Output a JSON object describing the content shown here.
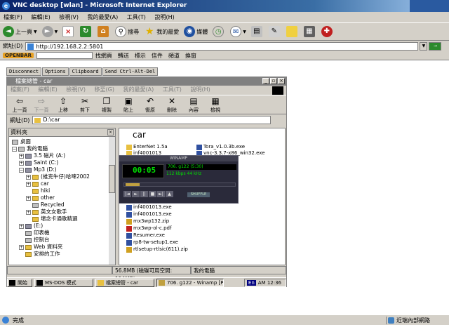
{
  "window": {
    "title": "VNC desktop [wlan] - Microsoft Internet Explorer"
  },
  "ie_menu": [
    "檔案(F)",
    "編輯(E)",
    "檢視(V)",
    "我的最愛(A)",
    "工具(T)",
    "說明(H)"
  ],
  "ie_toolbar": {
    "back": "上一頁",
    "search": "搜尋",
    "favorites": "我的最愛",
    "media": "媒體"
  },
  "address": {
    "label": "網址(D)",
    "url": "http://192.168.2.2:5801"
  },
  "links_bar": {
    "openbar": "OPENBAR",
    "items": [
      "找網頁",
      "轉送",
      "標示",
      "信件",
      "頻道",
      "換窗"
    ]
  },
  "vnc_buttons": [
    "Disconnect",
    "Options",
    "Clipboard",
    "Send Ctrl-Alt-Del"
  ],
  "explorer": {
    "title": "檔案總管 - car",
    "menu": [
      "檔案(F)",
      "編輯(E)",
      "檢視(V)",
      "移至(G)",
      "我的最愛(A)",
      "工具(T)",
      "說明(H)"
    ],
    "toolbar": [
      "上一頁",
      "下一頁",
      "上移",
      "剪下",
      "複製",
      "貼上",
      "復原",
      "刪除",
      "內容",
      "檢視"
    ],
    "address_label": "網址(D)",
    "path": "D:\\car",
    "tree_header": "資料夾",
    "tree": [
      "桌面",
      "我的電腦",
      "3.5 磁片 (A:)",
      "Saint (C:)",
      "Mp3 (D:)",
      "(維克牛仔)哈啤2002",
      "car",
      "hiki",
      "other",
      "Recycled",
      "英文女歌手",
      "壞念卡通歌精選",
      "(E:)",
      "印表機",
      "控制台",
      "Web 資料夾",
      "安排的工作"
    ],
    "folder_name": "car",
    "files": [
      "EnterNet 1.5a",
      "inf4001013",
      "Tora_v1.0.3b.exe",
      "vnc-3.3.7-x86_win32.exe",
      "inf4001013.exe",
      "inf4001013.exe",
      "mx3wp132.zip",
      "mx3wp-ol-c.pdf",
      "Resumer.exe",
      "rp8-tw-setup1.exe",
      "rtlsetup-rtlsic(611).zip"
    ],
    "status_size": "56.8MB (磁碟可用空間: 114MB)",
    "status_location": "我的電腦"
  },
  "winamp": {
    "title": "WINAMP",
    "time": "00:05",
    "song": "706. g122 (5:30)",
    "kbps": "112",
    "khz": "44",
    "shuffle": "SHUFFLE"
  },
  "taskbar": {
    "start": "開始",
    "items": [
      "MS-DOS 模式",
      "檔案總管 - car",
      "706. g122 - Winamp [Pa..."
    ],
    "lang": "En",
    "clock": "AM 12:36"
  },
  "statusbar": {
    "text": "完成",
    "zone": "近端內部網路"
  }
}
